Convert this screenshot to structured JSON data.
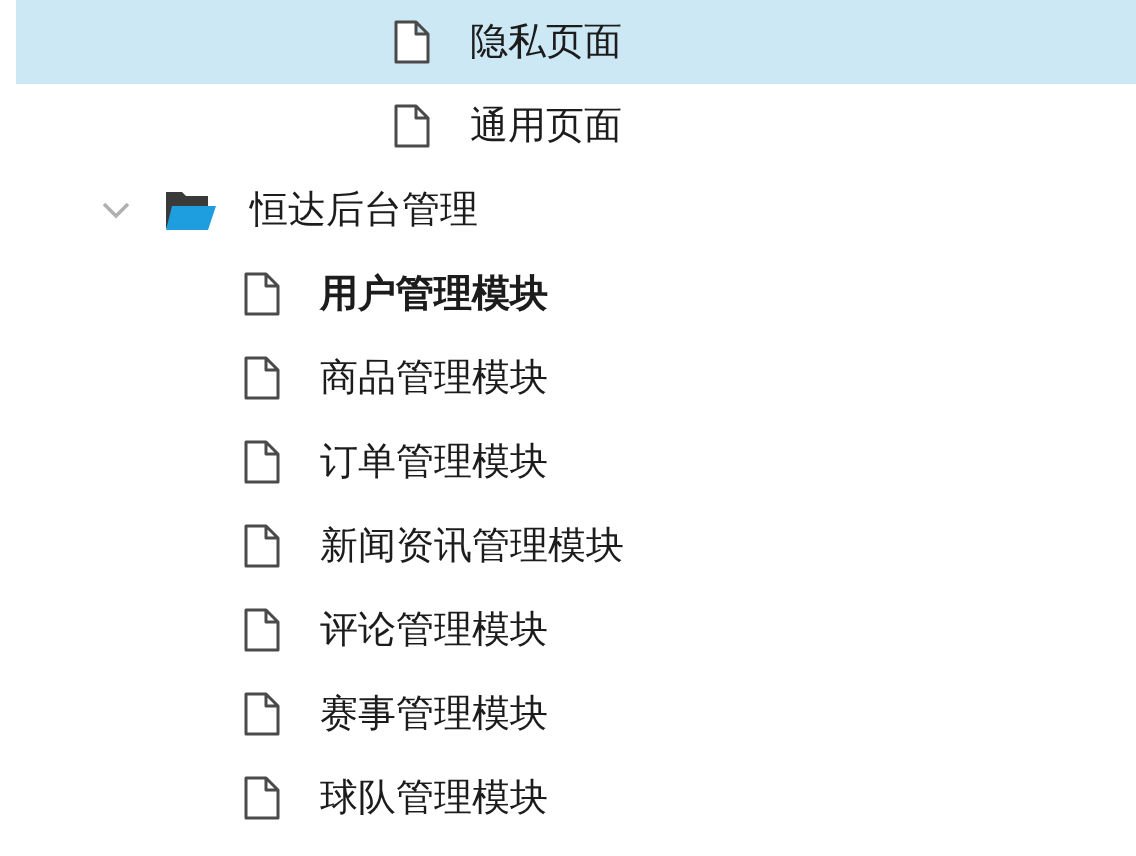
{
  "tree": [
    {
      "children": [
        {
          "children": [
            {
              "label": "隐私页面",
              "kind": "page",
              "selected": true,
              "bold": false
            },
            {
              "label": "通用页面",
              "kind": "page",
              "selected": false,
              "bold": false
            }
          ]
        }
      ]
    },
    {
      "label": "恒达后台管理",
      "kind": "folder",
      "selected": false,
      "bold": false,
      "expanded": true,
      "children": [
        {
          "label": "用户管理模块",
          "kind": "page",
          "selected": false,
          "bold": true
        },
        {
          "label": "商品管理模块",
          "kind": "page",
          "selected": false,
          "bold": false
        },
        {
          "label": "订单管理模块",
          "kind": "page",
          "selected": false,
          "bold": false
        },
        {
          "label": "新闻资讯管理模块",
          "kind": "page",
          "selected": false,
          "bold": false
        },
        {
          "label": "评论管理模块",
          "kind": "page",
          "selected": false,
          "bold": false
        },
        {
          "label": "赛事管理模块",
          "kind": "page",
          "selected": false,
          "bold": false
        },
        {
          "label": "球队管理模块",
          "kind": "page",
          "selected": false,
          "bold": false
        }
      ]
    }
  ]
}
